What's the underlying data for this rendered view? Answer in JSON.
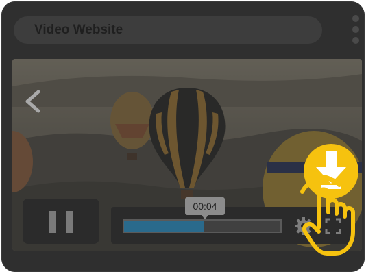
{
  "window": {
    "address_text": "Video Website"
  },
  "player": {
    "current_time": "00:04",
    "progress_fraction": 0.51,
    "state": "playing"
  },
  "icons": {
    "prev": "chevron-left-icon",
    "pause": "pause-icon",
    "settings": "gear-icon",
    "fullscreen": "fullscreen-icon",
    "download": "download-icon",
    "pointer": "hand-pointer-icon"
  },
  "colors": {
    "window_bg": "#2f2f2f",
    "progress_fill": "#2a6a8c",
    "accent": "#f6c20f"
  }
}
